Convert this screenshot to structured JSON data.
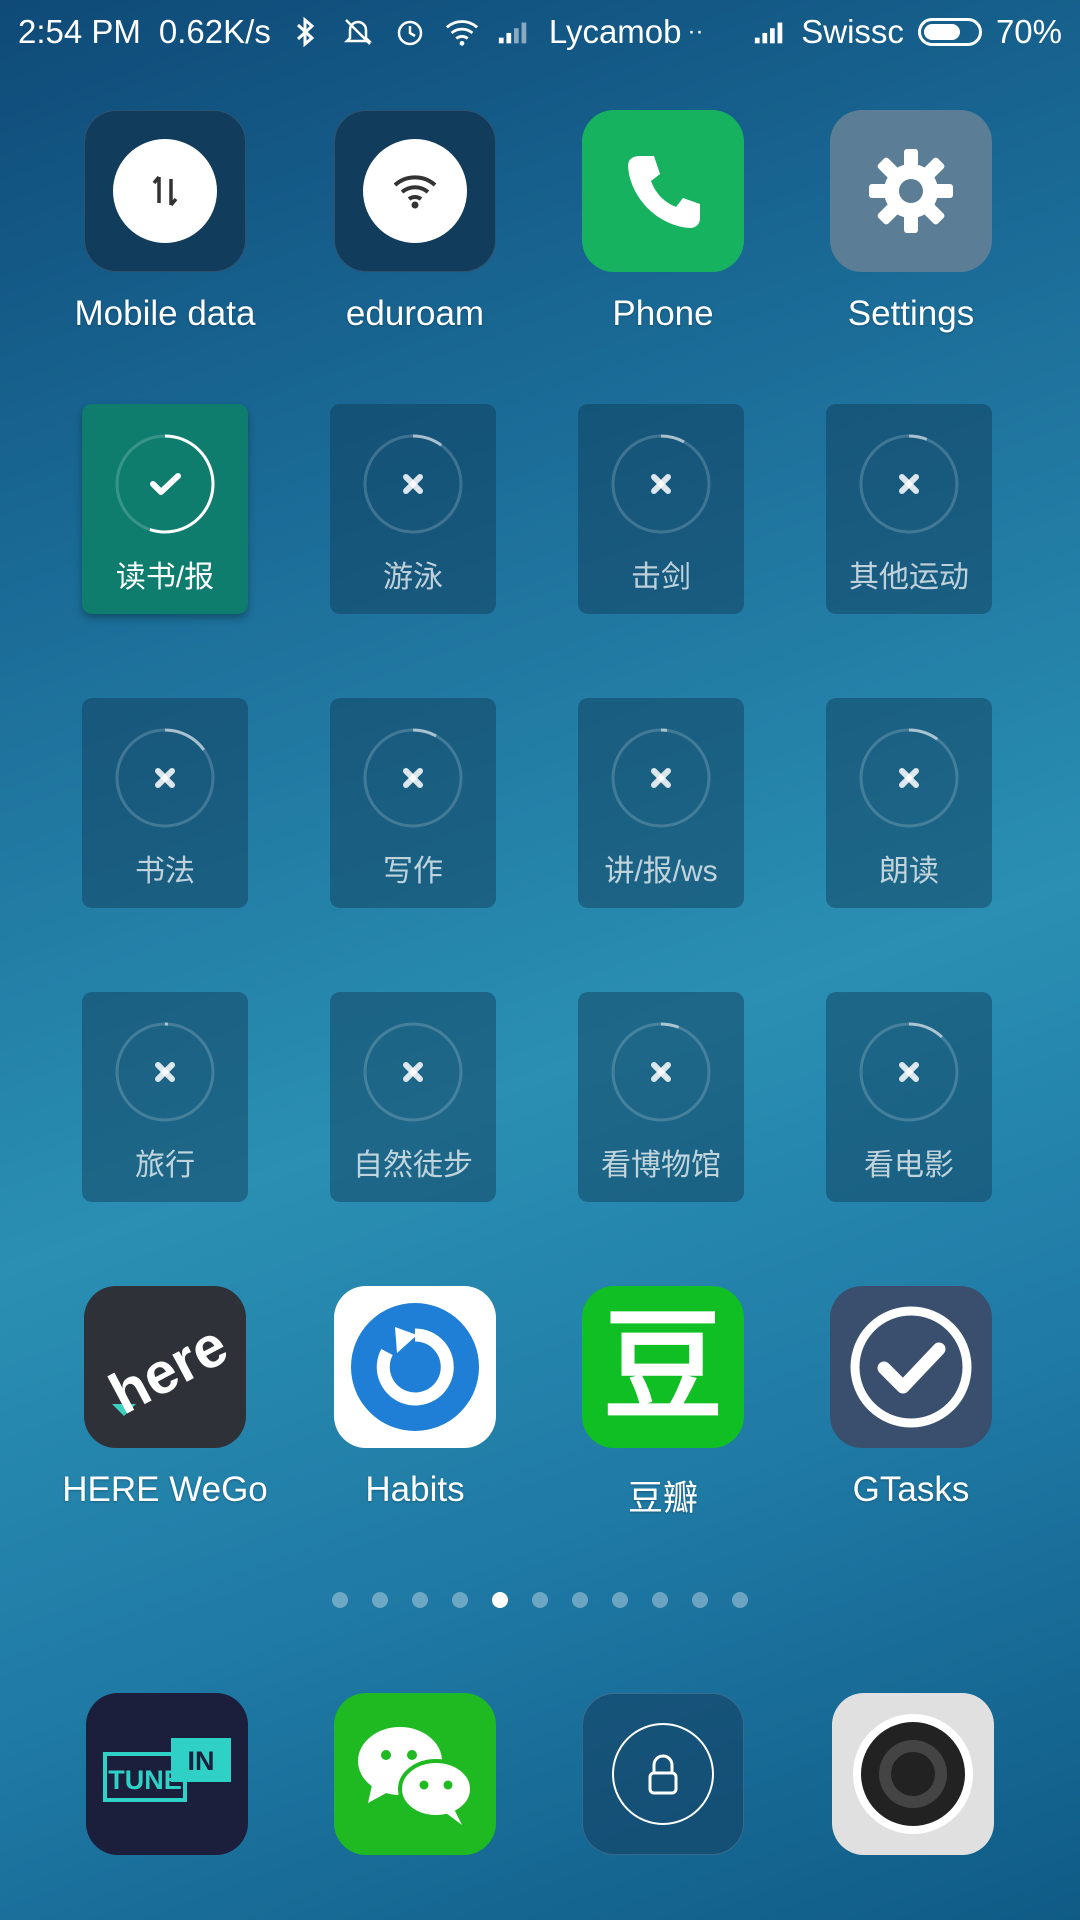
{
  "status_bar": {
    "time": "2:54 PM",
    "speed": "0.62K/s",
    "carrier1": "Lycamob",
    "carrier1_suffix": "··",
    "carrier2": "Swissc",
    "battery_pct": "70%",
    "battery_level": 0.7
  },
  "top_row": [
    {
      "label": "Mobile data",
      "icon": "data-transfer-icon"
    },
    {
      "label": "eduroam",
      "icon": "wifi-icon"
    },
    {
      "label": "Phone",
      "icon": "phone-icon",
      "color": "#17b25f"
    },
    {
      "label": "Settings",
      "icon": "gear-icon",
      "color": "#5b7d96"
    }
  ],
  "habit_tiles": [
    {
      "label": "读书/报",
      "state": "done",
      "progress": 0.55
    },
    {
      "label": "游泳",
      "state": "not-done",
      "progress": 0.1
    },
    {
      "label": "击剑",
      "state": "not-done",
      "progress": 0.08
    },
    {
      "label": "其他运动",
      "state": "not-done",
      "progress": 0.06
    },
    {
      "label": "书法",
      "state": "not-done",
      "progress": 0.15
    },
    {
      "label": "写作",
      "state": "not-done",
      "progress": 0.08
    },
    {
      "label": "讲/报/ws",
      "state": "not-done",
      "progress": 0.02
    },
    {
      "label": "朗读",
      "state": "not-done",
      "progress": 0.1
    },
    {
      "label": "旅行",
      "state": "not-done",
      "progress": 0.01
    },
    {
      "label": "自然徒步",
      "state": "not-done",
      "progress": 0.0
    },
    {
      "label": "看博物馆",
      "state": "not-done",
      "progress": 0.06
    },
    {
      "label": "看电影",
      "state": "not-done",
      "progress": 0.12
    }
  ],
  "apps_row": [
    {
      "label": "HERE WeGo",
      "icon": "here-logo-icon",
      "logo_text": "here"
    },
    {
      "label": "Habits",
      "icon": "habits-refresh-icon"
    },
    {
      "label": "豆瓣",
      "icon": "douban-icon",
      "logo_text": "豆"
    },
    {
      "label": "GTasks",
      "icon": "check-circle-icon"
    }
  ],
  "page_indicator": {
    "count": 11,
    "active": 4
  },
  "dock": [
    {
      "name": "tunein",
      "icon": "tunein-icon",
      "logo_left": "TUNE",
      "logo_right": "IN"
    },
    {
      "name": "wechat",
      "icon": "wechat-icon"
    },
    {
      "name": "lock",
      "icon": "lock-icon"
    },
    {
      "name": "camera",
      "icon": "camera-icon"
    }
  ]
}
